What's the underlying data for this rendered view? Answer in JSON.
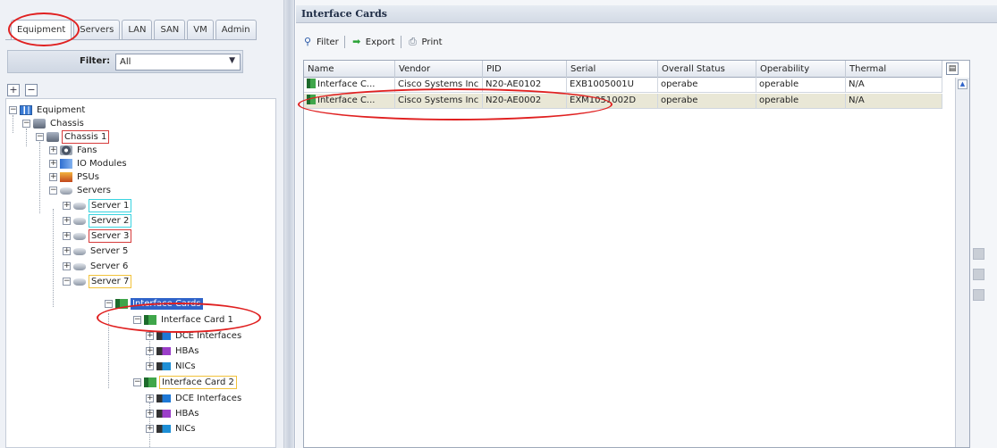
{
  "nav": {
    "tabs": [
      "Equipment",
      "Servers",
      "LAN",
      "SAN",
      "VM",
      "Admin"
    ],
    "filter_label": "Filter:",
    "filter_value": "All",
    "expand_all": "+",
    "collapse_all": "−"
  },
  "tree": {
    "equipment": "Equipment",
    "chassis_group": "Chassis",
    "chassis_1": "Chassis 1",
    "fans": "Fans",
    "io_modules": "IO Modules",
    "psus": "PSUs",
    "servers": "Servers",
    "server_1": "Server 1",
    "server_2": "Server 2",
    "server_3": "Server 3",
    "server_5": "Server 5",
    "server_6": "Server 6",
    "server_7": "Server 7",
    "interface_cards": "Interface Cards",
    "interface_card_1": "Interface Card 1",
    "dce_interfaces": "DCE Interfaces",
    "hbas": "HBAs",
    "nics": "NICs",
    "interface_card_2": "Interface Card 2"
  },
  "panel": {
    "title": "Interface Cards",
    "toolbar": {
      "filter": "Filter",
      "export": "Export",
      "print": "Print"
    }
  },
  "grid": {
    "columns": [
      "Name",
      "Vendor",
      "PID",
      "Serial",
      "Overall Status",
      "Operability",
      "Thermal"
    ],
    "rows": [
      {
        "name": "Interface C...",
        "vendor": "Cisco Systems Inc",
        "pid": "N20-AE0102",
        "serial": "EXB1005001U",
        "status": "operabe",
        "operability": "operable",
        "thermal": "N/A"
      },
      {
        "name": "Interface C...",
        "vendor": "Cisco Systems Inc",
        "pid": "N20-AE0002",
        "serial": "EXM1051002D",
        "status": "operabe",
        "operability": "operable",
        "thermal": "N/A"
      }
    ]
  },
  "colors": {
    "selection": "#2f63c9",
    "annotation": "#e02020",
    "accent_cyan": "#39d3e0",
    "accent_yellow": "#f2c23a"
  },
  "icons": [
    "equipment-icon",
    "chassis-icon",
    "fan-icon",
    "io-module-icon",
    "psu-icon",
    "server-icon",
    "interface-card-icon",
    "dce-interface-icon",
    "hba-icon",
    "nic-icon",
    "filter-icon",
    "export-icon",
    "print-icon"
  ]
}
